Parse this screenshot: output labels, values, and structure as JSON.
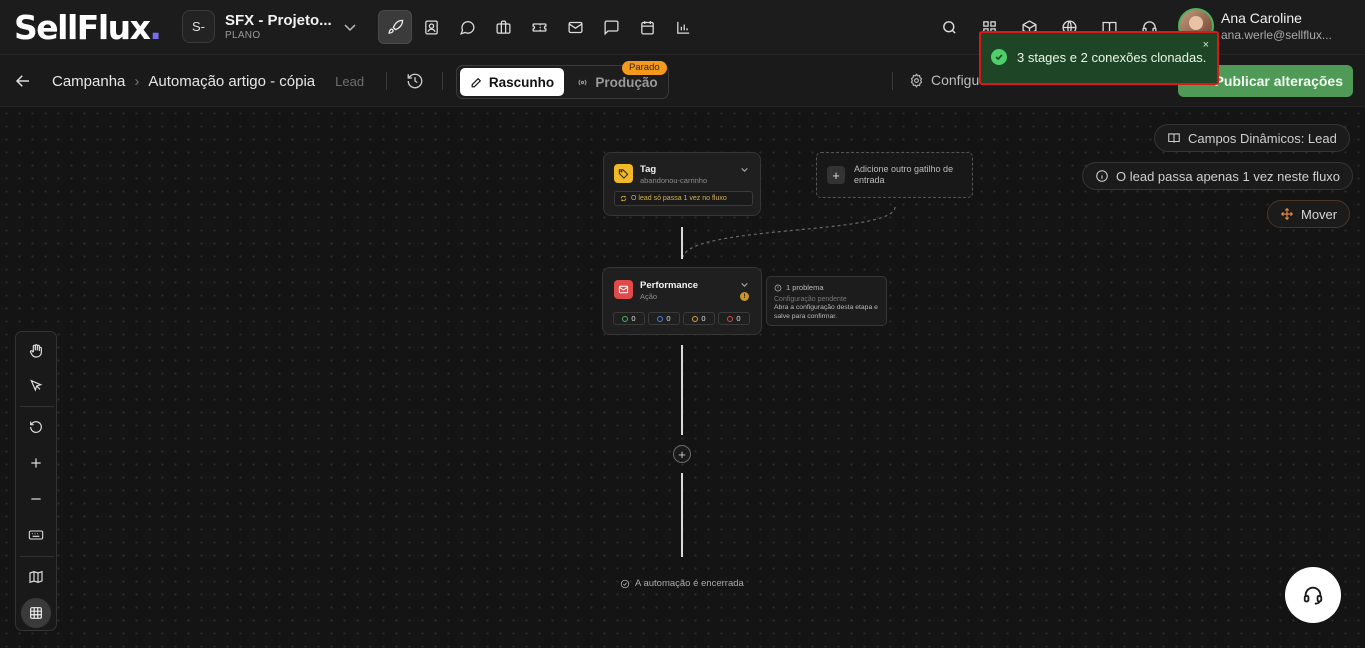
{
  "app": {
    "logo_text": "SellFlux",
    "logo_dot": "."
  },
  "project": {
    "avatar_text": "S-",
    "name": "SFX - Projeto...",
    "plan": "PLANO"
  },
  "nav_icons": [
    "rocket-icon",
    "contact-card-icon",
    "chat-bubble-icon",
    "briefcase-icon",
    "ticket-icon",
    "mail-icon",
    "message-square-icon",
    "calendar-icon",
    "bar-chart-icon"
  ],
  "right_icons": [
    "search-icon",
    "apps-grid-icon",
    "box-icon",
    "globe-icon",
    "book-icon",
    "headset-icon"
  ],
  "user": {
    "name": "Ana Caroline",
    "email": "ana.werle@sellflux..."
  },
  "breadcrumb": {
    "items": [
      "Campanha",
      "Automação artigo - cópia"
    ],
    "context": "Lead"
  },
  "mode_toggle": {
    "draft_label": "Rascunho",
    "production_label": "Produção",
    "production_badge": "Parado"
  },
  "toolbar_right": {
    "config_label": "Configu",
    "publish_label": "Publicar alterações"
  },
  "canvas_pills": {
    "dynamic_fields": "Campos Dinâmicos: Lead",
    "lead_once": "O lead passa apenas 1 vez neste fluxo",
    "move": "Mover"
  },
  "tag_stage": {
    "title": "Tag",
    "subtitle": "abandonou-carrinho",
    "note": "O lead só passa 1 vez no fluxo"
  },
  "add_trigger": {
    "plus": "+",
    "label": "Adicione outro gatilho de entrada"
  },
  "performance_stage": {
    "title": "Performance",
    "subtitle": "Ação",
    "warn_mark": "!",
    "stats": [
      {
        "value": "0",
        "color": "#4bb35f"
      },
      {
        "value": "0",
        "color": "#4a7fd6"
      },
      {
        "value": "0",
        "color": "#d9a13a"
      },
      {
        "value": "0",
        "color": "#d64a4a"
      }
    ]
  },
  "problem_panel": {
    "title": "1 problema",
    "subtitle": "Configuração pendente",
    "description": "Abra a configuração desta etapa e salve para confirmar."
  },
  "flow": {
    "add_node": "+",
    "end_label": "A automação é encerrada"
  },
  "tools": [
    "hand-icon",
    "pointer-icon",
    "undo-icon",
    "zoom-in-icon",
    "zoom-out-icon",
    "keyboard-icon",
    "map-icon",
    "grid-icon"
  ],
  "toast": {
    "message": "3 stages e 2 conexões clonadas.",
    "close": "×"
  },
  "colors": {
    "accent_green": "#4f9a57",
    "tag_yellow": "#f0b92a",
    "action_red": "#e04a4a",
    "badge_orange": "#f39a1e",
    "toast_bg": "#1f4527",
    "highlight_red": "#d61a1a"
  }
}
